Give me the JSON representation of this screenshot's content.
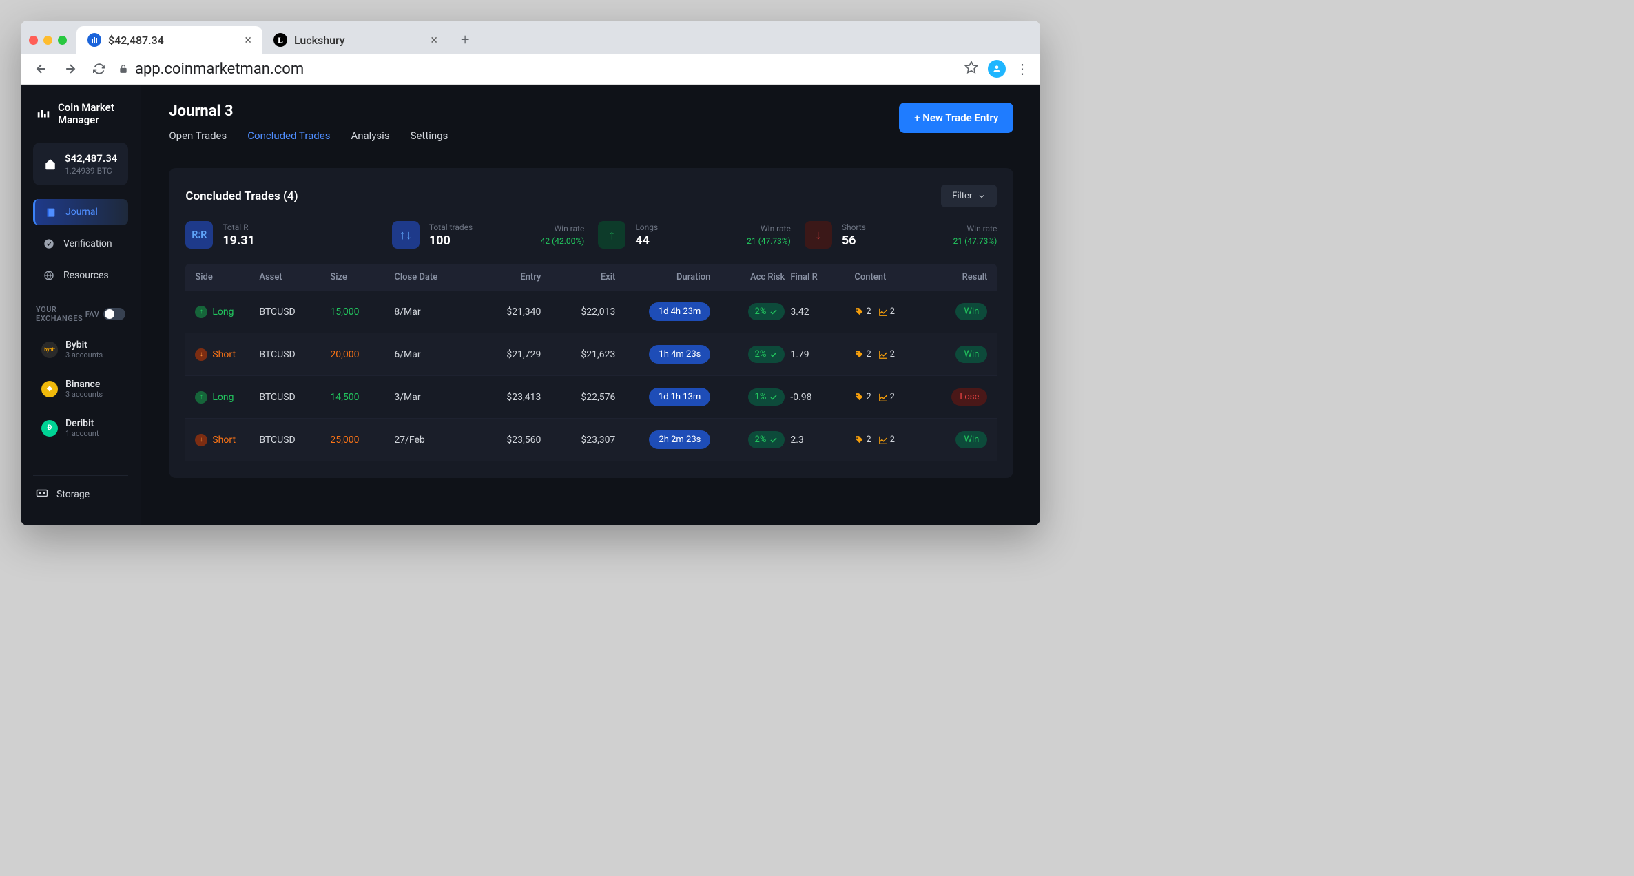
{
  "browser": {
    "tabs": [
      {
        "title": "$42,487.34",
        "favicon": "blue"
      },
      {
        "title": "Luckshury",
        "favicon": "black"
      }
    ],
    "url": "app.coinmarketman.com"
  },
  "sidebar": {
    "logo": "Coin Market\nManager",
    "balance_usd": "$42,487.34",
    "balance_btc": "1.24939 BTC",
    "nav": {
      "journal": "Journal",
      "verification": "Verification",
      "resources": "Resources"
    },
    "exchanges_label": "YOUR EXCHANGES",
    "fav_label": "FAV",
    "exchanges": [
      {
        "name": "Bybit",
        "sub": "3 accounts",
        "color": "#1a1f2b",
        "text": "bybit"
      },
      {
        "name": "Binance",
        "sub": "3 accounts",
        "color": "#f0b90b"
      },
      {
        "name": "Deribit",
        "sub": "1 account",
        "color": "#00d395"
      }
    ],
    "storage": "Storage"
  },
  "main": {
    "title": "Journal 3",
    "new_trade_btn": "+ New Trade Entry",
    "tabs": {
      "open": "Open Trades",
      "concluded": "Concluded Trades",
      "analysis": "Analysis",
      "settings": "Settings"
    },
    "panel_title": "Concluded Trades (4)",
    "filter_btn": "Filter",
    "stats": {
      "total_r_label": "Total R",
      "total_r_value": "19.31",
      "total_trades_label": "Total trades",
      "total_trades_value": "100",
      "trades_winrate_label": "Win rate",
      "trades_winrate_value": "42 (42.00%)",
      "longs_label": "Longs",
      "longs_value": "44",
      "longs_winrate_label": "Win rate",
      "longs_winrate_value": "21 (47.73%)",
      "shorts_label": "Shorts",
      "shorts_value": "56",
      "shorts_winrate_label": "Win rate",
      "shorts_winrate_value": "21 (47.73%)"
    },
    "columns": {
      "side": "Side",
      "asset": "Asset",
      "size": "Size",
      "close_date": "Close Date",
      "entry": "Entry",
      "exit": "Exit",
      "duration": "Duration",
      "acc_risk": "Acc Risk",
      "final_r": "Final R",
      "content": "Content",
      "result": "Result"
    },
    "rows": [
      {
        "side": "Long",
        "asset": "BTCUSD",
        "size": "15,000",
        "close_date": "8/Mar",
        "entry": "$21,340",
        "exit": "$22,013",
        "duration": "1d 4h 23m",
        "risk": "2%",
        "final_r": "3.42",
        "tags": "2",
        "charts": "2",
        "result": "Win"
      },
      {
        "side": "Short",
        "asset": "BTCUSD",
        "size": "20,000",
        "close_date": "6/Mar",
        "entry": "$21,729",
        "exit": "$21,623",
        "duration": "1h 4m 23s",
        "risk": "2%",
        "final_r": "1.79",
        "tags": "2",
        "charts": "2",
        "result": "Win"
      },
      {
        "side": "Long",
        "asset": "BTCUSD",
        "size": "14,500",
        "close_date": "3/Mar",
        "entry": "$23,413",
        "exit": "$22,576",
        "duration": "1d 1h 13m",
        "risk": "1%",
        "final_r": "-0.98",
        "tags": "2",
        "charts": "2",
        "result": "Lose"
      },
      {
        "side": "Short",
        "asset": "BTCUSD",
        "size": "25,000",
        "close_date": "27/Feb",
        "entry": "$23,560",
        "exit": "$23,307",
        "duration": "2h 2m 23s",
        "risk": "2%",
        "final_r": "2.3",
        "tags": "2",
        "charts": "2",
        "result": "Win"
      }
    ]
  }
}
